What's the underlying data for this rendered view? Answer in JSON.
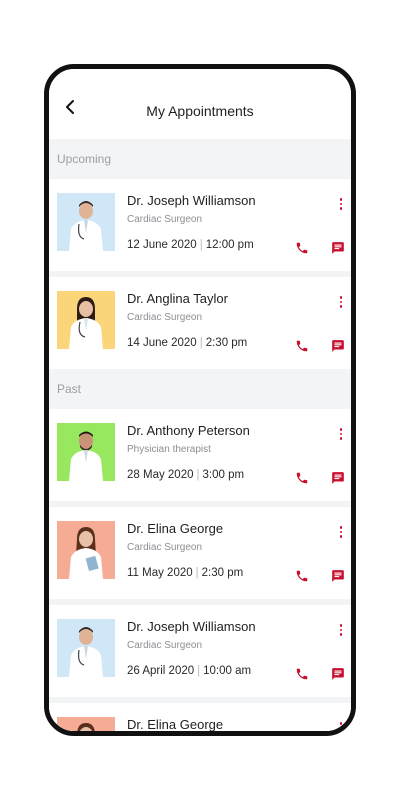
{
  "header": {
    "title": "My Appointments",
    "back_icon": "back-arrow-icon"
  },
  "sections": {
    "upcoming_label": "Upcoming",
    "past_label": "Past"
  },
  "colors": {
    "accent": "#c8102e",
    "section_bg": "#f2f4f5"
  },
  "upcoming": [
    {
      "name": "Dr. Joseph Williamson",
      "specialty": "Cardiac Surgeon",
      "date": "12 June 2020",
      "time": "12:00 pm",
      "avatar_bg": "#cfe7f7"
    },
    {
      "name": "Dr. Anglina Taylor",
      "specialty": "Cardiac Surgeon",
      "date": "14 June 2020",
      "time": "2:30 pm",
      "avatar_bg": "#fbd57a"
    }
  ],
  "past": [
    {
      "name": "Dr. Anthony Peterson",
      "specialty": "Physician therapist",
      "date": "28 May 2020",
      "time": "3:00 pm",
      "avatar_bg": "#97e85e"
    },
    {
      "name": "Dr. Elina George",
      "specialty": "Cardiac Surgeon",
      "date": "11 May 2020",
      "time": "2:30 pm",
      "avatar_bg": "#f6ab95"
    },
    {
      "name": "Dr. Joseph Williamson",
      "specialty": "Cardiac Surgeon",
      "date": "26 April 2020",
      "time": "10:00 am",
      "avatar_bg": "#cfe7f7"
    },
    {
      "name": "Dr. Elina George",
      "specialty": "",
      "date": "",
      "time": "",
      "avatar_bg": "#f6ab95"
    }
  ]
}
